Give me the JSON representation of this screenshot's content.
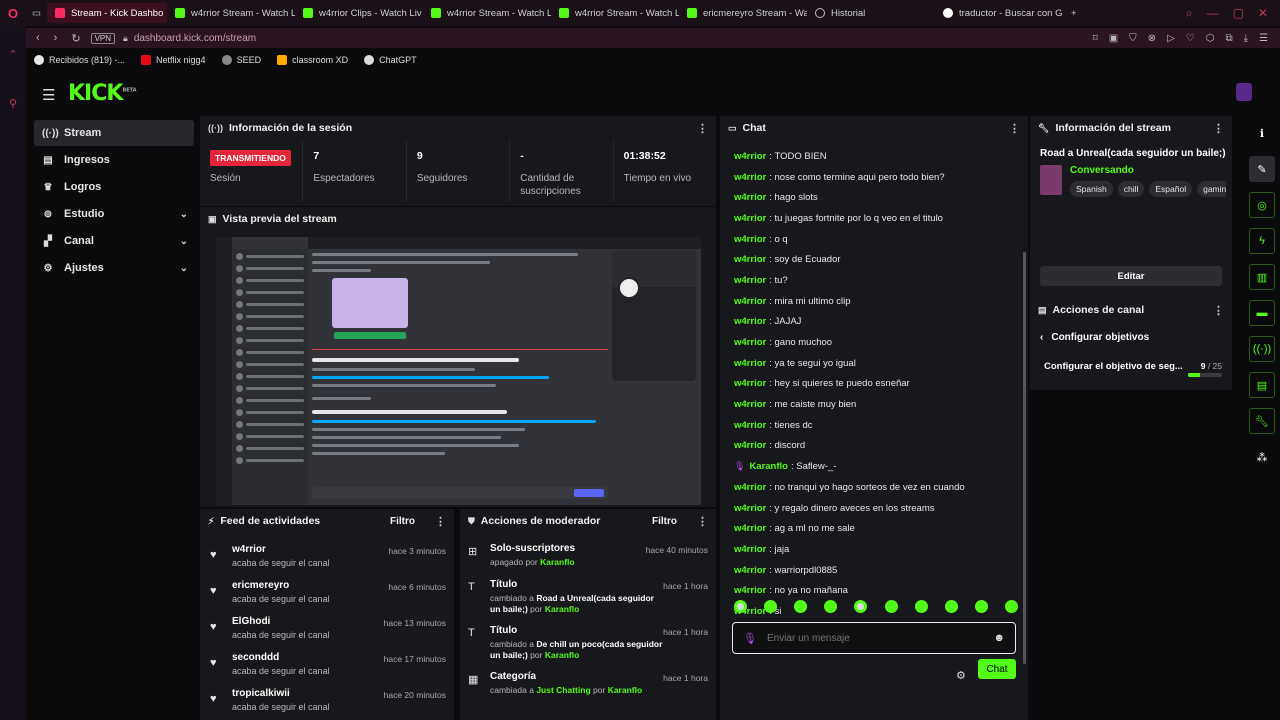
{
  "browser": {
    "tabs": [
      {
        "label": "Stream - Kick Dashbo",
        "active": true
      },
      {
        "label": "w4rrior Stream - Watch L"
      },
      {
        "label": "w4rrior Clips - Watch Liv"
      },
      {
        "label": "w4rrior Stream - Watch L"
      },
      {
        "label": "w4rrior Stream - Watch L"
      },
      {
        "label": "ericmereyro Stream - Wa"
      },
      {
        "label": "Historial"
      },
      {
        "label": "traductor - Buscar con Go"
      }
    ],
    "new_tab": "+",
    "url": "dashboard.kick.com/stream",
    "vpn": "VPN",
    "bookmarks": [
      "Recibidos (819) -...",
      "Netflix nigg4",
      "SEED",
      "classroom XD",
      "ChatGPT"
    ]
  },
  "app": {
    "logo": "KICK",
    "logo_badge": "BETA"
  },
  "sidebar": {
    "items": [
      {
        "label": "Stream",
        "icon": "broadcast-icon"
      },
      {
        "label": "Ingresos",
        "icon": "revenue-icon"
      },
      {
        "label": "Logros",
        "icon": "trophy-icon"
      },
      {
        "label": "Estudio",
        "icon": "studio-icon"
      },
      {
        "label": "Canal",
        "icon": "channel-icon"
      },
      {
        "label": "Ajustes",
        "icon": "gear-icon"
      }
    ]
  },
  "session": {
    "title": "Información de la sesión",
    "status": "TRANSMITIENDO",
    "status_label": "Sesión",
    "viewers": "7",
    "viewers_label": "Espectadores",
    "followers": "9",
    "followers_label": "Seguidores",
    "subs": "-",
    "subs_label": "Cantidad de suscripciones",
    "uptime": "01:38:52",
    "uptime_label": "Tiempo en vivo"
  },
  "preview": {
    "title": "Vista previa del stream"
  },
  "feed": {
    "title": "Feed de actividades",
    "filter": "Filtro",
    "items": [
      {
        "name": "w4rrior",
        "desc": "acaba de seguir el canal",
        "time": "hace 3 minutos"
      },
      {
        "name": "ericmereyro",
        "desc": "acaba de seguir el canal",
        "time": "hace 6 minutos"
      },
      {
        "name": "ElGhodi",
        "desc": "acaba de seguir el canal",
        "time": "hace 13 minutos"
      },
      {
        "name": "seconddd",
        "desc": "acaba de seguir el canal",
        "time": "hace 17 minutos"
      },
      {
        "name": "tropicalkiwii",
        "desc": "acaba de seguir el canal",
        "time": "hace 20 minutos"
      }
    ]
  },
  "mod": {
    "title": "Acciones de moderador",
    "filter": "Filtro",
    "items": [
      {
        "name": "Solo-suscriptores",
        "pre": "apagado por",
        "obj": "",
        "mid": "",
        "user": "Karanflo",
        "time": "hace 40 minutos"
      },
      {
        "name": "Título",
        "pre": "cambiado a",
        "obj": "Road a Unreal(cada seguidor un baile;)",
        "mid": "por",
        "user": "Karanflo",
        "time": "hace 1 hora"
      },
      {
        "name": "Título",
        "pre": "cambiado a",
        "obj": "De chill un poco(cada seguidor un baile;)",
        "mid": "por",
        "user": "Karanflo",
        "time": "hace 1 hora"
      },
      {
        "name": "Categoría",
        "pre": "cambiada a",
        "obj": "Just Chatting",
        "mid": "por",
        "user": "Karanflo",
        "time": "hace 1 hora"
      }
    ]
  },
  "chat": {
    "title": "Chat",
    "messages": [
      {
        "user": "w4rrior",
        "text": "TODO BIEN"
      },
      {
        "user": "w4rrior",
        "text": "nose como termine aqui pero todo bien?"
      },
      {
        "user": "w4rrior",
        "text": "hago slots"
      },
      {
        "user": "w4rrior",
        "text": "tu juegas fortnite por lo q veo en el titulo"
      },
      {
        "user": "w4rrior",
        "text": "o q"
      },
      {
        "user": "w4rrior",
        "text": "soy de Ecuador"
      },
      {
        "user": "w4rrior",
        "text": "tu?"
      },
      {
        "user": "w4rrior",
        "text": "mira mi ultimo clip"
      },
      {
        "user": "w4rrior",
        "text": "JAJAJ"
      },
      {
        "user": "w4rrior",
        "text": "gano muchoo"
      },
      {
        "user": "w4rrior",
        "text": "ya te segui yo igual"
      },
      {
        "user": "w4rrior",
        "text": "hey si quieres te puedo esneñar"
      },
      {
        "user": "w4rrior",
        "text": "me caiste muy bien"
      },
      {
        "user": "w4rrior",
        "text": "tienes dc"
      },
      {
        "user": "w4rrior",
        "text": "discord"
      },
      {
        "user": "Karanflo",
        "text": "Saflew-_-",
        "mic": true
      },
      {
        "user": "w4rrior",
        "text": "no tranqui yo hago sorteos de vez en cuando"
      },
      {
        "user": "w4rrior",
        "text": "y regalo dinero aveces en los streams"
      },
      {
        "user": "w4rrior",
        "text": "ag a ml no me sale"
      },
      {
        "user": "w4rrior",
        "text": "jaja"
      },
      {
        "user": "w4rrior",
        "text": "warriorpdl0885"
      },
      {
        "user": "w4rrior",
        "text": "no ya no mañana"
      },
      {
        "user": "w4rrior",
        "text": "si"
      }
    ],
    "placeholder": "Enviar un mensaje",
    "send": "Chat"
  },
  "stream_info": {
    "title": "Información del stream",
    "stream_title": "Road a Unreal(cada seguidor un baile;)",
    "category": "Conversando",
    "tags": [
      "Spanish",
      "chill",
      "Español",
      "gaming"
    ],
    "edit": "Editar"
  },
  "channel_actions": {
    "title": "Acciones de canal",
    "back_label": "Configurar objetivos",
    "goal_label": "Configurar el objetivo de seg...",
    "goal_current": "9",
    "goal_total": "/ 25",
    "goal_fraction": 0.36
  },
  "colors": {
    "accent": "#53fc18",
    "live": "#e5253a",
    "panel": "#17181b"
  }
}
